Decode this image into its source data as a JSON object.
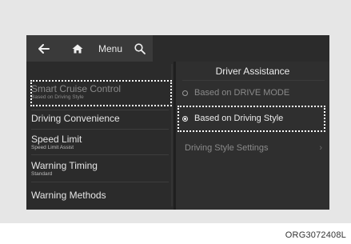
{
  "topbar": {
    "menu_label": "Menu",
    "icons": [
      "back-arrow-icon",
      "home-icon",
      "search-icon"
    ]
  },
  "left_menu": {
    "items": [
      {
        "title": "Smart Cruise Control",
        "subtitle": "Based on  Driving Style"
      },
      {
        "title": "Driving Convenience",
        "subtitle": ""
      },
      {
        "title": "Speed Limit",
        "subtitle": "Speed Limit Assist"
      },
      {
        "title": "Warning Timing",
        "subtitle": "Standard"
      },
      {
        "title": "Warning Methods",
        "subtitle": ""
      }
    ]
  },
  "right_panel": {
    "header": "Driver Assistance",
    "options": [
      {
        "label": "Based on DRIVE MODE",
        "selected": false
      },
      {
        "label": "Based on Driving Style",
        "selected": true
      }
    ],
    "settings_label": "Driving Style Settings",
    "settings_chevron": "›"
  },
  "caption": "ORG3072408L",
  "colors": {
    "screen_bg": "#2b2b2b",
    "highlight": "#ffffff",
    "frame_bg": "#e6e6e6"
  }
}
